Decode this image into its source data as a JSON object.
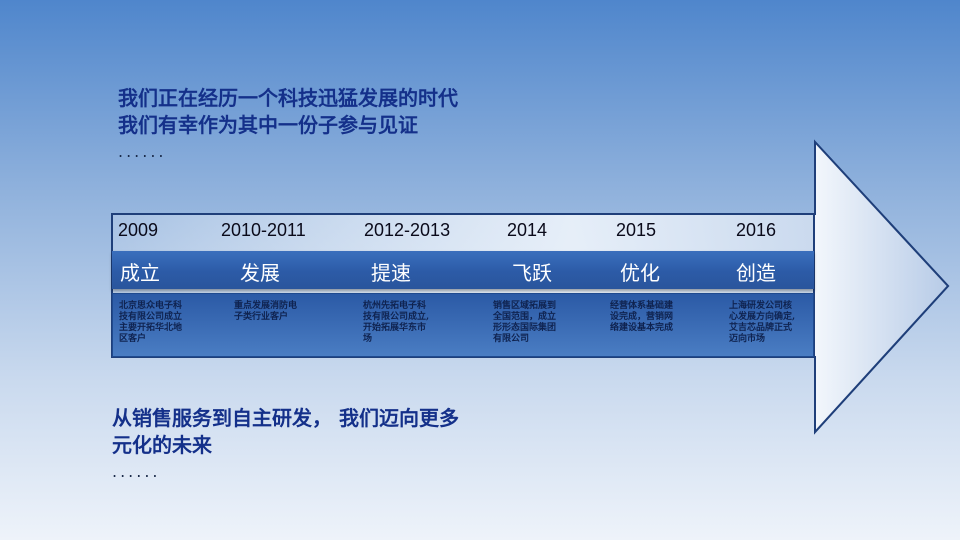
{
  "intro": {
    "line1": "我们正在经历一个科技迅猛发展的时代",
    "line2": "我们有幸作为其中一份子参与见证",
    "dots": "......"
  },
  "timeline": {
    "years": [
      "2009",
      "2010-2011",
      "2012-2013",
      "2014",
      "2015",
      "2016"
    ],
    "stages": [
      "成立",
      "发展",
      "提速",
      "飞跃",
      "优化",
      "创造"
    ],
    "descriptions": [
      [
        "北京思众电子科",
        "技有限公司成立",
        "主要开拓华北地",
        "区客户"
      ],
      [
        "重点发展消防电",
        "子类行业客户"
      ],
      [
        "杭州先拓电子科",
        "技有限公司成立,",
        "开始拓展华东市",
        "场"
      ],
      [
        "销售区域拓展到",
        "全国范围，成立",
        "形形态国际集团",
        "有限公司"
      ],
      [
        "经营体系基础建",
        "设完成，营销网",
        "络建设基本完成"
      ],
      [
        "上海研发公司核",
        "心发展方向确定,",
        "艾吉芯品牌正式",
        "迈向市场"
      ]
    ]
  },
  "outro": {
    "line1": "从销售服务到自主研发， 我们迈向更多元化的未来",
    "dots": "......"
  },
  "colors": {
    "title_text": "#14308a",
    "stage_bar": "#2c5ba7",
    "arrow_head": "#e6eef8",
    "arrow_border": "#1f3f7a"
  }
}
